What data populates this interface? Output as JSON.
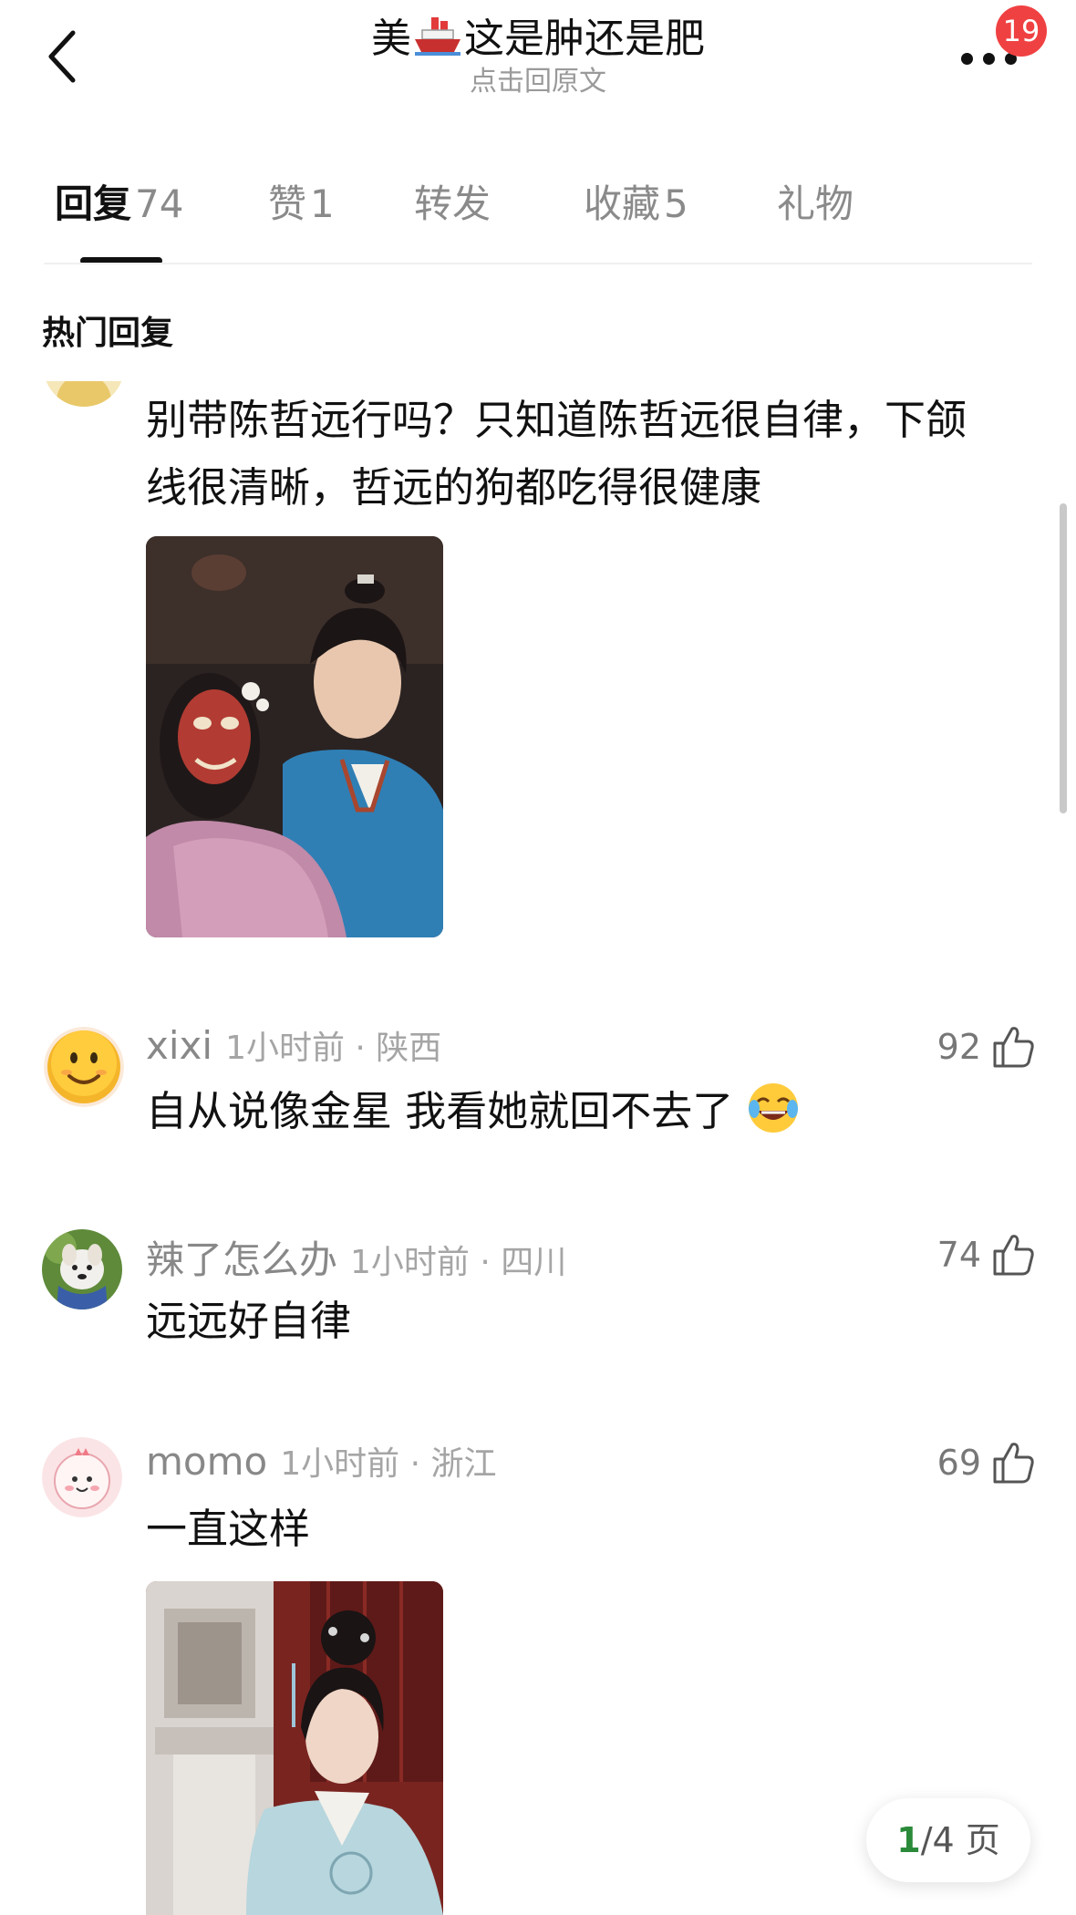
{
  "header": {
    "title_prefix": "美",
    "title_suffix": "这是肿还是肥",
    "title_emoji": "ship-emoji",
    "subtitle": "点击回原文",
    "badge_count": "19"
  },
  "tabs": [
    {
      "label": "回复",
      "count": "74",
      "active": true
    },
    {
      "label": "赞",
      "count": "1"
    },
    {
      "label": "转发",
      "count": ""
    },
    {
      "label": "收藏",
      "count": "5"
    },
    {
      "label": "礼物",
      "count": ""
    }
  ],
  "section_title": "热门回复",
  "comments": [
    {
      "text_line1": "别带陈哲远行吗？只知道陈哲远很自律，下颌",
      "text_line2": "线很清晰，哲远的狗都吃得很健康",
      "photo": "drama-still-masked-woman-and-man-in-blue"
    },
    {
      "user": "xixi",
      "time_location": "1小时前 · 陕西",
      "likes": "92",
      "text": "自从说像金星 我看她就回不去了",
      "avatar": "smiley-face-avatar"
    },
    {
      "user": "辣了怎么办",
      "time_location": "1小时前 · 四川",
      "likes": "74",
      "text": "远远好自律",
      "avatar": "dog-avatar"
    },
    {
      "user": "momo",
      "time_location": "1小时前 · 浙江",
      "likes": "69",
      "text": "一直这样",
      "avatar": "pink-cartoon-avatar",
      "photo": "drama-still-woman-in-light-blue-robe"
    }
  ],
  "pager": {
    "current": "1",
    "rest": "/4 页"
  },
  "colors": {
    "badge": "#f04142",
    "pager_current": "#2a8a3a",
    "meta": "#8f8f8f"
  }
}
